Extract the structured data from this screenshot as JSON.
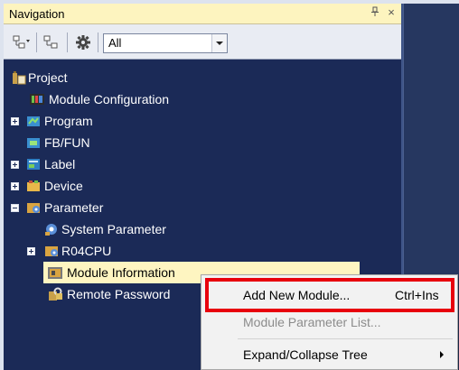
{
  "panel": {
    "title": "Navigation",
    "pin_glyph": "↕",
    "close_glyph": "×"
  },
  "toolbar": {
    "filter_value": "All",
    "buttons": [
      "collapse-tree-icon",
      "expand-tree-icon",
      "settings-gear-icon"
    ]
  },
  "tree": {
    "project": "Project",
    "module_configuration": "Module Configuration",
    "program": "Program",
    "fb_fun": "FB/FUN",
    "label": "Label",
    "device": "Device",
    "parameter": "Parameter",
    "system_parameter": "System Parameter",
    "cpu": "R04CPU",
    "module_information": "Module Information",
    "remote_password": "Remote Password"
  },
  "context_menu": {
    "add_new_module": "Add New Module...",
    "add_new_module_shortcut": "Ctrl+Ins",
    "module_parameter_list": "Module Parameter List...",
    "expand_collapse_tree": "Expand/Collapse Tree"
  },
  "colors": {
    "tree_background": "#1b2a57",
    "title_background": "#fdf4bf",
    "selection": "#fef5c1",
    "highlight_border": "#e8000d"
  }
}
